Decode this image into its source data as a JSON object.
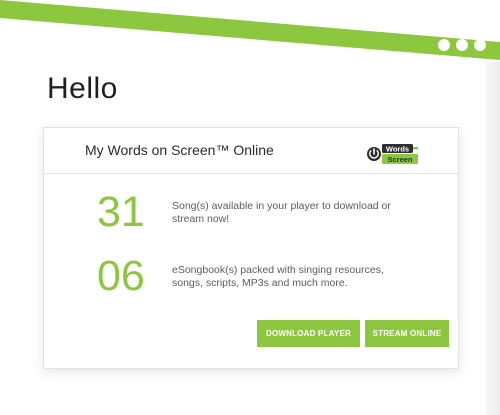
{
  "greeting": "Hello",
  "card": {
    "title": "My Words on Screen™ Online",
    "logo_text": "Words Screen"
  },
  "stats": [
    {
      "number": "31",
      "text": "Song(s) available in your player to download or stream now!"
    },
    {
      "number": "06",
      "text": "eSongbook(s) packed with singing resources, songs, scripts, MP3s and much more."
    }
  ],
  "buttons": {
    "download": "DOWNLOAD PLAYER",
    "stream": "STREAM ONLINE"
  },
  "colors": {
    "accent": "#8dc63f",
    "text": "#2b2b2b"
  },
  "icons": [
    "window-dot-icon",
    "words-on-screen-logo"
  ]
}
